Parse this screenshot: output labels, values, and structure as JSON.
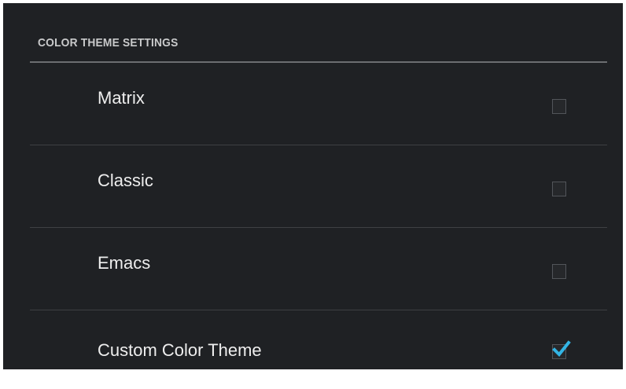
{
  "section": {
    "title": "COLOR THEME SETTINGS"
  },
  "preferences": [
    {
      "title": "Matrix",
      "checked": false,
      "checkbox_icon": "checkbox-unchecked-icon"
    },
    {
      "title": "Classic",
      "checked": false,
      "checkbox_icon": "checkbox-unchecked-icon"
    },
    {
      "title": "Emacs",
      "checked": false,
      "checkbox_icon": "checkbox-unchecked-icon"
    },
    {
      "title": "Custom Color Theme",
      "checked": true,
      "checkbox_icon": "checkbox-checked-icon"
    }
  ],
  "colors": {
    "background": "#1f2124",
    "accent_check": "#33b5e5",
    "divider": "#3e4043",
    "header_rule": "#6c6e71"
  }
}
